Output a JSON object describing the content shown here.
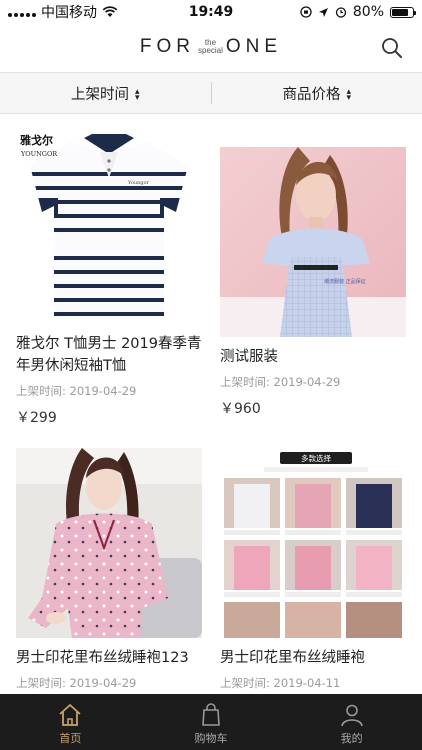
{
  "status": {
    "carrier": "中国移动",
    "time": "19:49",
    "battery": "80%",
    "battery_level": 0.8
  },
  "header": {
    "logo_left": "FOR",
    "logo_top": "the",
    "logo_bottom": "special",
    "logo_right": "ONE",
    "search_icon": "search-icon"
  },
  "sort": {
    "time_label": "上架时间",
    "price_label": "商品价格"
  },
  "products": [
    {
      "brand_cn": "雅戈尔",
      "brand_en": "YOUNGOR",
      "title": "雅戈尔 T恤男士 2019春季青年男休闲短袖T恤",
      "date": "上架时间: 2019-04-29",
      "price": "￥299"
    },
    {
      "title": "测试服装",
      "date": "上架时间: 2019-04-29",
      "price": "￥960"
    },
    {
      "title": "男士印花里布丝绒睡袍123",
      "date": "上架时间: 2019-04-29"
    },
    {
      "banner": "多款选择",
      "title": "男士印花里布丝绒睡袍",
      "date": "上架时间: 2019-04-11"
    }
  ],
  "tabs": [
    {
      "label": "首页",
      "icon": "home-icon"
    },
    {
      "label": "购物车",
      "icon": "cart-icon"
    },
    {
      "label": "我的",
      "icon": "profile-icon"
    }
  ],
  "colors": {
    "accent": "#c9a26d",
    "tabbar": "#1c1c1c",
    "sortbar": "#f5f5f5"
  }
}
